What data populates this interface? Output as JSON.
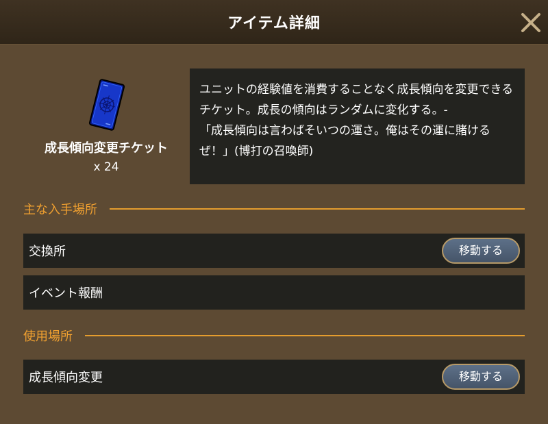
{
  "header": {
    "title": "アイテム詳細",
    "close_icon": "close-icon"
  },
  "item": {
    "icon": "blue-ticket-icon",
    "name": "成長傾向変更チケット",
    "count": "x 24",
    "description": "ユニットの経験値を消費することなく成長傾向を変更できるチケット。成長の傾向はランダムに変化する。-\n「成長傾向は言わばそいつの運さ。俺はその運に賭けるぜ！」(博打の召喚師)"
  },
  "acquisition": {
    "label": "主な入手場所",
    "rows": [
      {
        "label": "交換所",
        "button": "移動する"
      },
      {
        "label": "イベント報酬"
      }
    ]
  },
  "usage": {
    "label": "使用場所",
    "rows": [
      {
        "label": "成長傾向変更",
        "button": "移動する"
      }
    ]
  },
  "colors": {
    "background": "#5d4a33",
    "header": "#3a2d1f",
    "accent": "#f0a030",
    "row_background": "#22221e",
    "button_fill": "#51627a",
    "button_border": "#b79a68"
  }
}
